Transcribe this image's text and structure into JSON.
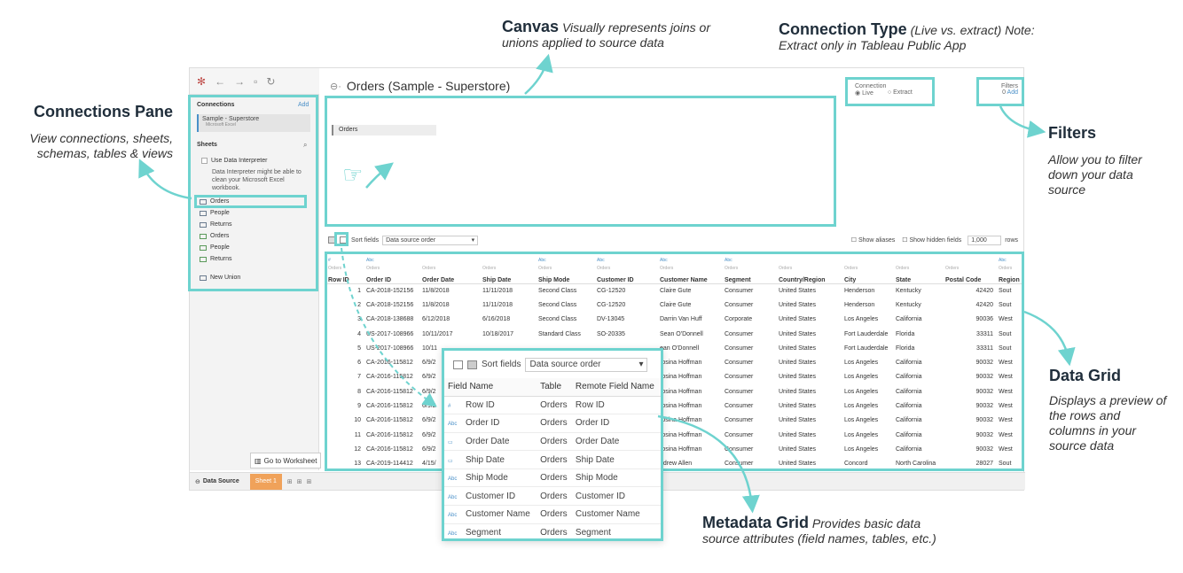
{
  "annotations": {
    "canvas": {
      "title": "Canvas",
      "desc_line1": "Visually represents joins or",
      "desc_line2": "unions applied to source data"
    },
    "connection_type": {
      "title": "Connection Type",
      "desc_line1": "(Live vs. extract) Note:",
      "desc_line2": "Extract only in Tableau Public App"
    },
    "connections_pane": {
      "title": "Connections Pane",
      "desc_line1": "View connections, sheets,",
      "desc_line2": "schemas, tables & views"
    },
    "filters": {
      "title": "Filters",
      "desc_line1": "Allow you to filter",
      "desc_line2": "down your data",
      "desc_line3": "source"
    },
    "data_grid": {
      "title": "Data Grid",
      "desc_line1": "Displays a preview of",
      "desc_line2": "the rows and",
      "desc_line3": "columns in your",
      "desc_line4": "source data"
    },
    "metadata_grid": {
      "title": "Metadata Grid",
      "desc_line1": "Provides basic data",
      "desc_line2": "source attributes (field names, tables, etc.)"
    }
  },
  "app": {
    "title": "Orders (Sample - Superstore)",
    "connections_label": "Connections",
    "add_label": "Add",
    "connection_name": "Sample - Superstore",
    "connection_type": "Microsoft Excel",
    "sheets_label": "Sheets",
    "use_interpreter": "Use Data Interpreter",
    "interpreter_note_1": "Data Interpreter might be able to",
    "interpreter_note_2": "clean your Microsoft Excel",
    "interpreter_note_3": "workbook.",
    "sheets": [
      "Orders",
      "People",
      "Returns"
    ],
    "named_ranges": [
      "Orders",
      "People",
      "Returns"
    ],
    "new_union": "New Union",
    "canvas_table": "Orders",
    "connection_box": {
      "label": "Connection",
      "live": "Live",
      "extract": "Extract"
    },
    "filters_box": {
      "label": "Filters",
      "count": "0",
      "add": "Add"
    },
    "sort_fields_label": "Sort fields",
    "sort_order": "Data source order",
    "show_aliases": "Show aliases",
    "show_hidden": "Show hidden fields",
    "rows_value": "1,000",
    "rows_label": "rows",
    "go_to_worksheet": "Go to Worksheet",
    "data_source_tab": "Data Source",
    "sheet_tab": "Sheet 1"
  },
  "data_grid": {
    "types": [
      "#",
      "Abc",
      "",
      "",
      "Abc",
      "Abc",
      "Abc",
      "Abc",
      "",
      "",
      "",
      "",
      "Abc"
    ],
    "source": [
      "Orders",
      "Orders",
      "Orders",
      "Orders",
      "Orders",
      "Orders",
      "Orders",
      "Orders",
      "Orders",
      "Orders",
      "Orders",
      "Orders",
      "Orders"
    ],
    "columns": [
      "Row ID",
      "Order ID",
      "Order Date",
      "Ship Date",
      "Ship Mode",
      "Customer ID",
      "Customer Name",
      "Segment",
      "Country/Region",
      "City",
      "State",
      "Postal Code",
      "Region"
    ],
    "rows": [
      [
        "1",
        "CA-2018-152156",
        "11/8/2018",
        "11/11/2018",
        "Second Class",
        "CG-12520",
        "Claire Gute",
        "Consumer",
        "United States",
        "Henderson",
        "Kentucky",
        "42420",
        "Sout"
      ],
      [
        "2",
        "CA-2018-152156",
        "11/8/2018",
        "11/11/2018",
        "Second Class",
        "CG-12520",
        "Claire Gute",
        "Consumer",
        "United States",
        "Henderson",
        "Kentucky",
        "42420",
        "Sout"
      ],
      [
        "3",
        "CA-2018-138688",
        "6/12/2018",
        "6/16/2018",
        "Second Class",
        "DV-13045",
        "Darrin Van Huff",
        "Corporate",
        "United States",
        "Los Angeles",
        "California",
        "90036",
        "West"
      ],
      [
        "4",
        "US-2017-108966",
        "10/11/2017",
        "10/18/2017",
        "Standard Class",
        "SO-20335",
        "Sean O'Donnell",
        "Consumer",
        "United States",
        "Fort Lauderdale",
        "Florida",
        "33311",
        "Sout"
      ],
      [
        "5",
        "US-2017-108966",
        "10/11",
        "",
        "",
        "",
        "ean O'Donnell",
        "Consumer",
        "United States",
        "Fort Lauderdale",
        "Florida",
        "33311",
        "Sout"
      ],
      [
        "6",
        "CA-2016-115812",
        "6/9/2",
        "",
        "",
        "",
        "rosina Hoffman",
        "Consumer",
        "United States",
        "Los Angeles",
        "California",
        "90032",
        "West"
      ],
      [
        "7",
        "CA-2016-115812",
        "6/9/2",
        "",
        "",
        "",
        "rosina Hoffman",
        "Consumer",
        "United States",
        "Los Angeles",
        "California",
        "90032",
        "West"
      ],
      [
        "8",
        "CA-2016-115812",
        "6/9/2",
        "",
        "",
        "",
        "rosina Hoffman",
        "Consumer",
        "United States",
        "Los Angeles",
        "California",
        "90032",
        "West"
      ],
      [
        "9",
        "CA-2016-115812",
        "6/9/2",
        "",
        "",
        "",
        "rosina Hoffman",
        "Consumer",
        "United States",
        "Los Angeles",
        "California",
        "90032",
        "West"
      ],
      [
        "10",
        "CA-2016-115812",
        "6/9/2",
        "",
        "",
        "",
        "rosina Hoffman",
        "Consumer",
        "United States",
        "Los Angeles",
        "California",
        "90032",
        "West"
      ],
      [
        "11",
        "CA-2016-115812",
        "6/9/2",
        "",
        "",
        "",
        "rosina Hoffman",
        "Consumer",
        "United States",
        "Los Angeles",
        "California",
        "90032",
        "West"
      ],
      [
        "12",
        "CA-2016-115812",
        "6/9/2",
        "",
        "",
        "",
        "rosina Hoffman",
        "Consumer",
        "United States",
        "Los Angeles",
        "California",
        "90032",
        "West"
      ],
      [
        "13",
        "CA-2019-114412",
        "4/15/",
        "",
        "",
        "",
        "ndrew Allen",
        "Consumer",
        "United States",
        "Concord",
        "North Carolina",
        "28027",
        "Sout"
      ]
    ]
  },
  "metadata_grid": {
    "sort_fields_label": "Sort fields",
    "sort_order": "Data source order",
    "headers": [
      "Field Name",
      "Table",
      "Remote Field Name"
    ],
    "rows": [
      {
        "type": "#",
        "field": "Row ID",
        "table": "Orders",
        "remote": "Row ID"
      },
      {
        "type": "Abc",
        "field": "Order ID",
        "table": "Orders",
        "remote": "Order ID"
      },
      {
        "type": "date",
        "field": "Order Date",
        "table": "Orders",
        "remote": "Order Date"
      },
      {
        "type": "date",
        "field": "Ship Date",
        "table": "Orders",
        "remote": "Ship Date"
      },
      {
        "type": "Abc",
        "field": "Ship Mode",
        "table": "Orders",
        "remote": "Ship Mode"
      },
      {
        "type": "Abc",
        "field": "Customer ID",
        "table": "Orders",
        "remote": "Customer ID"
      },
      {
        "type": "Abc",
        "field": "Customer Name",
        "table": "Orders",
        "remote": "Customer Name"
      },
      {
        "type": "Abc",
        "field": "Segment",
        "table": "Orders",
        "remote": "Segment"
      }
    ]
  },
  "colors": {
    "highlight": "#6ed3cf",
    "sheet_tab": "#f0a25a",
    "accent_blue": "#4a90c8"
  }
}
